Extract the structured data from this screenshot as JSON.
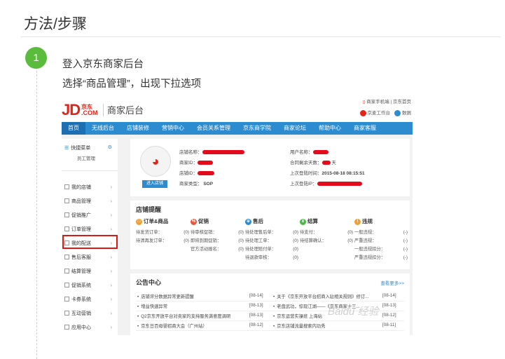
{
  "heading": "方法/步骤",
  "step": {
    "number": "1",
    "line1": "登入京东商家后台",
    "line2": "选择“商品管理”，出现下拉选项"
  },
  "shot": {
    "logo_text": "JD",
    "logo_sub": "京东",
    "logo_com": ".COM",
    "title": "商家后台",
    "top_link_mobile": "商家手机端",
    "top_link_home": "京东首页",
    "tool_workbench": "京麦工作台",
    "tool_data": "数据",
    "nav": [
      "首页",
      "无线后台",
      "店铺装修",
      "营销中心",
      "会员关系管理",
      "京东商学院",
      "商家论坛",
      "帮助中心",
      "商家客服"
    ],
    "sidebar": {
      "quick_menu": "快捷菜单",
      "staff_manage": "员工管理",
      "items": [
        "我的店铺",
        "商品管理",
        "促销推广",
        "订单管理",
        "我的配送",
        "售后客服",
        "结算管理",
        "促销系统",
        "卡券系统",
        "互动营销",
        "应用中心"
      ]
    },
    "profile": {
      "enter_button": "进入店铺",
      "shop_name_label": "店铺名称：",
      "merchant_id_label": "商家ID：",
      "shop_id_label": "店铺ID：",
      "merchant_type_label": "商家类型：",
      "merchant_type_value": "SOP",
      "username_label": "用户名称：",
      "contract_days_label": "合同剩余天数：",
      "contract_days_unit": "天",
      "last_login_time_label": "上次登陆时间：",
      "last_login_time_value": "2015-08-18 08:15:51",
      "last_login_ip_label": "上次登陆IP："
    },
    "remind": {
      "title": "店铺提醒",
      "columns": [
        {
          "title": "订单&商品",
          "color": "#f0a030",
          "rows": [
            [
              "待发货订单：",
              "(0)"
            ],
            [
              "待清再发订单：",
              "(0)"
            ]
          ]
        },
        {
          "title": "促销",
          "color": "#e9553d",
          "rows": [
            [
              "待审核促销：",
              "(0)"
            ],
            [
              "即将到期促销：",
              "(0)"
            ],
            [
              "官方活动报名：",
              "(0)"
            ]
          ]
        },
        {
          "title": "售后",
          "color": "#2d8bd0",
          "rows": [
            [
              "待处理售后单：",
              "(0)"
            ],
            [
              "待处理工单：",
              "(0)"
            ],
            [
              "待处理赔付单：",
              "(0)"
            ],
            [
              "待退款审核：",
              "(0)"
            ]
          ]
        },
        {
          "title": "结算",
          "color": "#4cb748",
          "rows": [
            [
              "待支付：",
              "(0)"
            ],
            [
              "待结算确认：",
              "(0)"
            ]
          ]
        },
        {
          "title": "违规",
          "color": "#f0a030",
          "rows": [
            [
              "一般违规：",
              "(-)"
            ],
            [
              "严重违规：",
              "(-)"
            ],
            [
              "一般违规扣分：",
              "(-)"
            ],
            [
              "严重违规扣分：",
              "(-)"
            ]
          ]
        }
      ]
    },
    "notice": {
      "title": "公告中心",
      "more": "查看更多>>",
      "left": [
        [
          "店铺评分数据异常更新提醒",
          "[08-14]"
        ],
        [
          "增益快速异常",
          "[08-13]"
        ],
        [
          "Q2京东开放平台对卖家的支持服务满意度调研",
          "[08-13]"
        ],
        [
          "京东日百母婴招商大会（广州站）",
          "[08-12]"
        ]
      ],
      "right": [
        [
          "关于《京东开放平台招商入驻相关规则》修订...",
          "[08-14]"
        ],
        [
          "老盘武功，惊现江湖——《京东商家十三...",
          "[08-13]"
        ],
        [
          "京东运营实操班 上海站",
          "[08-12]"
        ],
        [
          "京东店铺流量搜索内功秀",
          "[08-11]"
        ]
      ]
    },
    "watermark": "Baidu 经验"
  }
}
